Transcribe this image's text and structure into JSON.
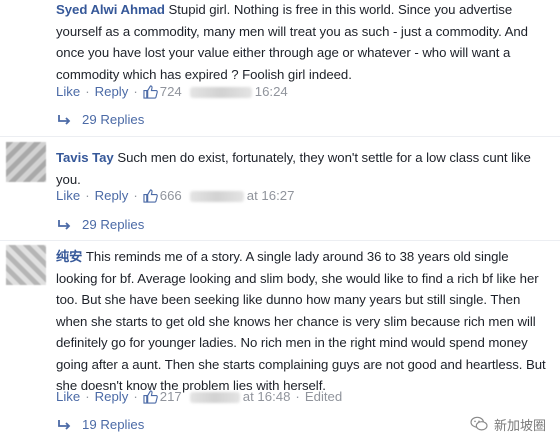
{
  "comments": [
    {
      "author": "Syed Alwi Ahmad",
      "text": "Stupid girl. Nothing is free in this world. Since you advertise yourself as a commodity, many men will treat you as such - just a commodity. And once you have lost your value either through age or whatever - who will want a commodity which has expired ? Foolish girl indeed.",
      "like_label": "Like",
      "reply_label": "Reply",
      "like_count": "724",
      "time": "16:24",
      "edited": "",
      "replies": "29 Replies"
    },
    {
      "author": "Tavis Tay",
      "text": "Such men do exist, fortunately, they won't settle for a low class cunt like you.",
      "like_label": "Like",
      "reply_label": "Reply",
      "like_count": "666",
      "time": "at 16:27",
      "edited": "",
      "replies": "29 Replies"
    },
    {
      "author": "纯安",
      "text": "This reminds me of a story. A single lady around 36 to 38 years old single looking for bf. Average looking and slim body, she would like to find a rich bf like her too. But she have been seeking like dunno how many years but still single. Then when she starts to get old she knows her chance is very slim because rich men will definitely go for younger ladies. No rich men in the right mind would spend money going after a aunt. Then she starts complaining guys are not good and heartless. But she doesn't know the problem lies with herself.",
      "like_label": "Like",
      "reply_label": "Reply",
      "like_count": "217",
      "time": "at 16:48",
      "edited": "Edited",
      "replies": "19 Replies"
    }
  ],
  "watermark": {
    "text": "新加坡圈",
    "icon": "wechat-icon"
  },
  "icons": {
    "like": "thumbs-up-icon",
    "reply": "reply-arrow-icon"
  },
  "colors": {
    "author": "#365899",
    "link": "#4b6aa6",
    "meta": "#90949c"
  }
}
